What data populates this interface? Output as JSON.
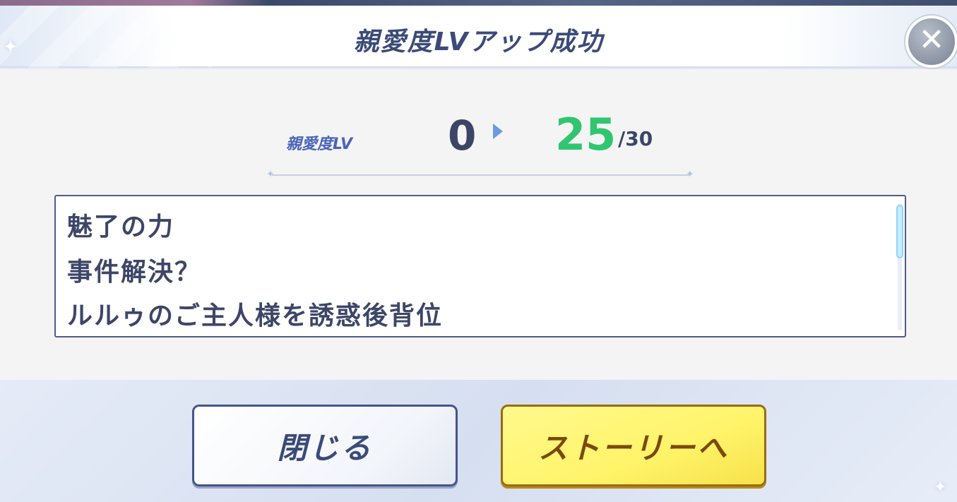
{
  "dialog": {
    "title": "親愛度LVアップ成功",
    "close_icon": "close-icon",
    "close_glyph": "✕"
  },
  "affinity": {
    "label": "親愛度LV",
    "previous_level": "0",
    "new_level": "25",
    "max_level": "/30",
    "arrow_icon": "arrow-right-icon"
  },
  "unlocked_stories": [
    "魅了の力",
    "事件解決？",
    "ルルゥのご主人様を誘惑後背位"
  ],
  "buttons": {
    "close_label": "閉じる",
    "story_label": "ストーリーへ"
  },
  "colors": {
    "title": "#3b4a78",
    "new_level": "#2fc66f",
    "story_button": "#fff46a",
    "close_button_border": "#45548a"
  }
}
